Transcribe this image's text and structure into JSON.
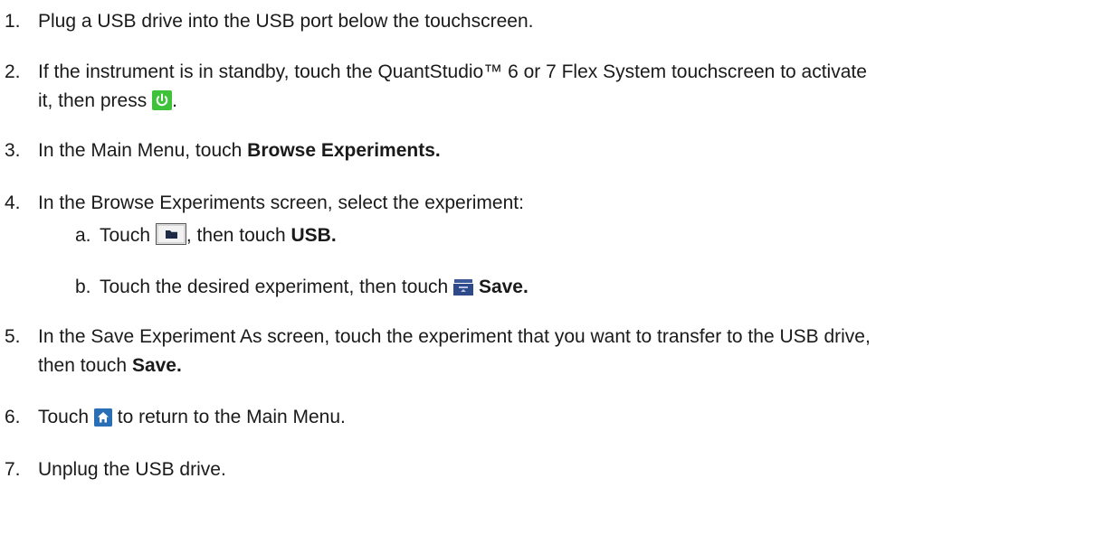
{
  "steps": [
    {
      "num": "1.",
      "text": "Plug a USB drive into the USB port below the touchscreen."
    },
    {
      "num": "2.",
      "text_a": "If the instrument is in standby, touch the QuantStudio™ 6 or 7 Flex System touchscreen to activate",
      "text_b": "it, then press",
      "text_c": "."
    },
    {
      "num": "3.",
      "text": "In the Main Menu, touch",
      "bold": "Browse Experiments."
    },
    {
      "num": "4.",
      "text": "In the Browse Experiments screen, select the experiment:"
    },
    {
      "num": "a.",
      "text_a": "Touch",
      "text_b": ", then touch",
      "bold": "USB."
    },
    {
      "num": "b.",
      "text": "Touch the desired experiment, then touch",
      "bold": "Save."
    },
    {
      "num": "5.",
      "text_a": "In the Save Experiment As screen, touch the experiment that you want to transfer to the USB drive,",
      "text_b": "then touch",
      "bold": "Save."
    },
    {
      "num": "6.",
      "text_a": "Touch",
      "text_b": "to return to the Main Menu."
    },
    {
      "num": "7.",
      "text": "Unplug the USB drive."
    }
  ],
  "icons": {
    "power": "power-icon",
    "folder": "folder-icon",
    "save": "save-icon",
    "home": "home-icon"
  },
  "colors": {
    "power_bg": "#3ec23a",
    "save_bg": "#2f4a8a",
    "home_bg": "#2a6fb5"
  }
}
